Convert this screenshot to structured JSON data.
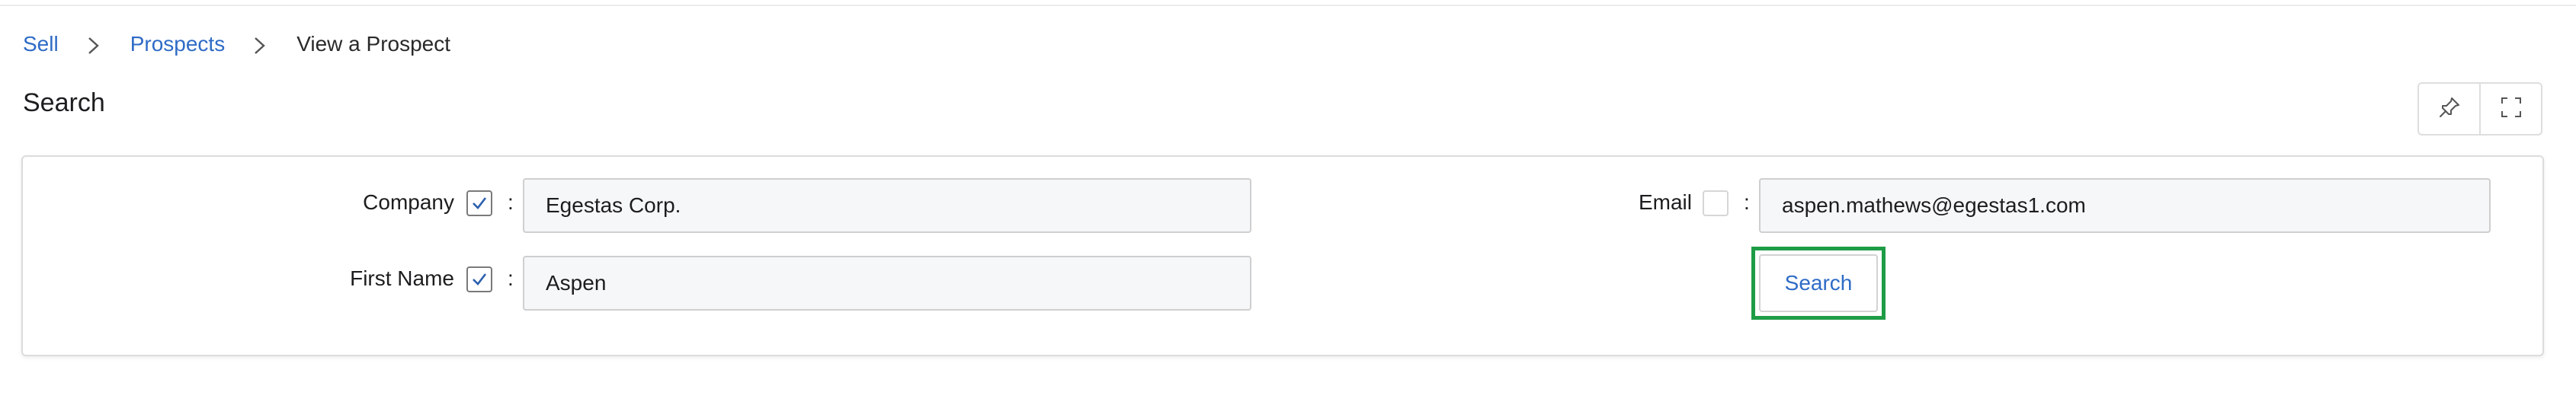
{
  "breadcrumb": {
    "items": [
      {
        "label": "Sell"
      },
      {
        "label": "Prospects"
      },
      {
        "label": "View a Prospect"
      }
    ]
  },
  "page": {
    "title": "Search"
  },
  "toolbar": {
    "icons": [
      "pin-icon",
      "fullscreen-icon"
    ]
  },
  "form": {
    "company": {
      "label": "Company",
      "checked": true,
      "value": "Egestas Corp."
    },
    "first_name": {
      "label": "First Name",
      "checked": true,
      "value": "Aspen"
    },
    "email": {
      "label": "Email",
      "checked": false,
      "value": "aspen.mathews@egestas1.com"
    },
    "separator": ":",
    "search_label": "Search"
  },
  "colors": {
    "link": "#2f6bc6",
    "highlight": "#1e9c46"
  }
}
